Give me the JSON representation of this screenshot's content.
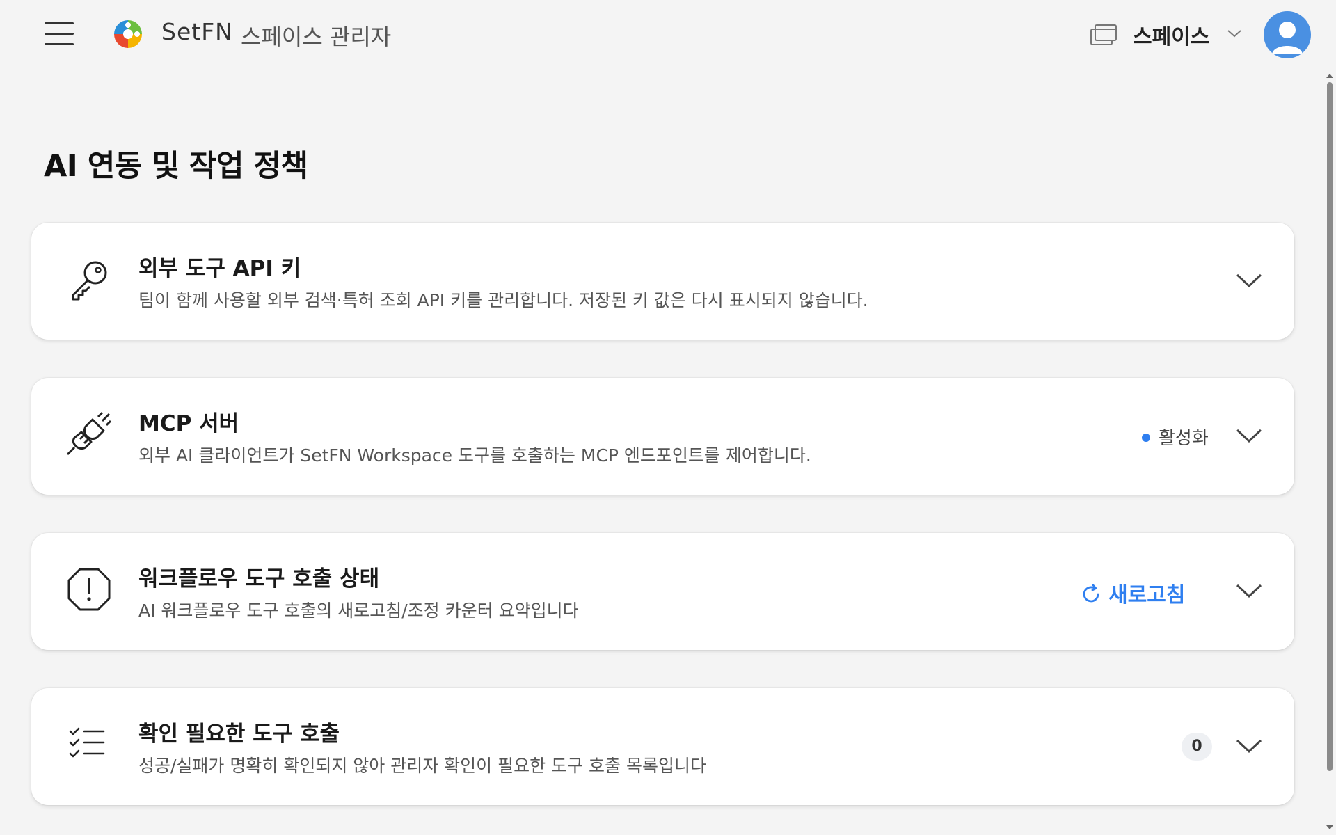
{
  "header": {
    "brand": "SetFN",
    "app_title": "스페이스 관리자",
    "space_label": "스페이스"
  },
  "page": {
    "title": "AI 연동 및 작업 정책"
  },
  "cards": [
    {
      "title": "외부 도구 API 키",
      "description": "팀이 함께 사용할 외부 검색·특허 조회 API 키를 관리합니다. 저장된 키 값은 다시 표시되지 않습니다.",
      "icon": "key-icon"
    },
    {
      "title": "MCP 서버",
      "description": "외부 AI 클라이언트가 SetFN Workspace 도구를 호출하는 MCP 엔드포인트를 제어합니다.",
      "icon": "plug-icon",
      "status": "활성화",
      "status_color": "#2f7ff0"
    },
    {
      "title": "워크플로우 도구 호출 상태",
      "description": "AI 워크플로우 도구 호출의 새로고침/조정 카운터 요약입니다",
      "icon": "alert-octagon-icon",
      "action_label": "새로고침"
    },
    {
      "title": "확인 필요한 도구 호출",
      "description": "성공/실패가 명확히 확인되지 않아 관리자 확인이 필요한 도구 호출 목록입니다",
      "icon": "checklist-icon",
      "count": "0"
    }
  ],
  "colors": {
    "accent": "#2f7ff0",
    "background": "#f4f4f4",
    "card": "#ffffff"
  }
}
